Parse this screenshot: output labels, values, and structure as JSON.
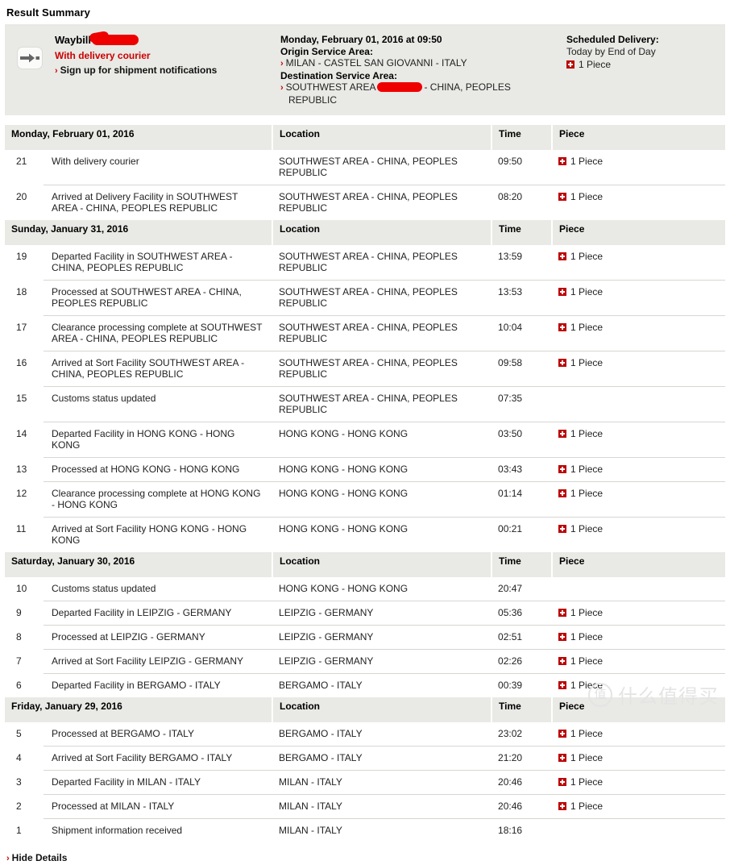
{
  "page": {
    "title": "Result Summary",
    "footer_link": "Hide Details",
    "footer_chevron": "›"
  },
  "summary": {
    "icon": "shipment-arrow-icon",
    "waybill_label": "Waybill",
    "waybill_redacted": true,
    "status": "With delivery courier",
    "notify_link": "Sign up for shipment notifications",
    "notify_chevron": "›",
    "datetime": "Monday, February 01, 2016 at 09:50",
    "origin_label": "Origin Service Area:",
    "origin_value": "MILAN - CASTEL SAN GIOVANNI - ITALY",
    "origin_chevron": "›",
    "destination_label": "Destination Service Area:",
    "destination_chevron": "›",
    "destination_prefix": "SOUTHWEST AREA",
    "destination_redacted": true,
    "destination_suffix": "- CHINA, PEOPLES",
    "destination_line2": "REPUBLIC",
    "scheduled_label": "Scheduled Delivery:",
    "scheduled_value": "Today by End of Day",
    "scheduled_piece": "1 Piece"
  },
  "columns": {
    "location": "Location",
    "time": "Time",
    "piece": "Piece"
  },
  "groups": [
    {
      "date": "Monday, February 01, 2016",
      "events": [
        {
          "num": "21",
          "desc": "With delivery courier",
          "loc": "SOUTHWEST AREA - CHINA, PEOPLES REPUBLIC",
          "time": "09:50",
          "piece": "1 Piece"
        },
        {
          "num": "20",
          "desc": "Arrived at Delivery Facility in SOUTHWEST AREA - CHINA, PEOPLES REPUBLIC",
          "loc": "SOUTHWEST AREA - CHINA, PEOPLES REPUBLIC",
          "time": "08:20",
          "piece": "1 Piece"
        }
      ]
    },
    {
      "date": "Sunday, January 31, 2016",
      "events": [
        {
          "num": "19",
          "desc": "Departed Facility in SOUTHWEST AREA - CHINA, PEOPLES REPUBLIC",
          "loc": "SOUTHWEST AREA - CHINA, PEOPLES REPUBLIC",
          "time": "13:59",
          "piece": "1 Piece"
        },
        {
          "num": "18",
          "desc": "Processed at SOUTHWEST AREA - CHINA, PEOPLES REPUBLIC",
          "loc": "SOUTHWEST AREA - CHINA, PEOPLES REPUBLIC",
          "time": "13:53",
          "piece": "1 Piece"
        },
        {
          "num": "17",
          "desc": "Clearance processing complete at SOUTHWEST AREA - CHINA, PEOPLES REPUBLIC",
          "loc": "SOUTHWEST AREA - CHINA, PEOPLES REPUBLIC",
          "time": "10:04",
          "piece": "1 Piece"
        },
        {
          "num": "16",
          "desc": "Arrived at Sort Facility SOUTHWEST AREA - CHINA, PEOPLES REPUBLIC",
          "loc": "SOUTHWEST AREA - CHINA, PEOPLES REPUBLIC",
          "time": "09:58",
          "piece": "1 Piece"
        },
        {
          "num": "15",
          "desc": "Customs status updated",
          "loc": "SOUTHWEST AREA - CHINA, PEOPLES REPUBLIC",
          "time": "07:35",
          "piece": ""
        },
        {
          "num": "14",
          "desc": "Departed Facility in HONG KONG - HONG KONG",
          "loc": "HONG KONG - HONG KONG",
          "time": "03:50",
          "piece": "1 Piece"
        },
        {
          "num": "13",
          "desc": "Processed at HONG KONG - HONG KONG",
          "loc": "HONG KONG - HONG KONG",
          "time": "03:43",
          "piece": "1 Piece"
        },
        {
          "num": "12",
          "desc": "Clearance processing complete at HONG KONG - HONG KONG",
          "loc": "HONG KONG - HONG KONG",
          "time": "01:14",
          "piece": "1 Piece"
        },
        {
          "num": "11",
          "desc": "Arrived at Sort Facility HONG KONG - HONG KONG",
          "loc": "HONG KONG - HONG KONG",
          "time": "00:21",
          "piece": "1 Piece"
        }
      ]
    },
    {
      "date": "Saturday, January 30, 2016",
      "events": [
        {
          "num": "10",
          "desc": "Customs status updated",
          "loc": "HONG KONG - HONG KONG",
          "time": "20:47",
          "piece": ""
        },
        {
          "num": "9",
          "desc": "Departed Facility in LEIPZIG - GERMANY",
          "loc": "LEIPZIG - GERMANY",
          "time": "05:36",
          "piece": "1 Piece"
        },
        {
          "num": "8",
          "desc": "Processed at LEIPZIG - GERMANY",
          "loc": "LEIPZIG - GERMANY",
          "time": "02:51",
          "piece": "1 Piece"
        },
        {
          "num": "7",
          "desc": "Arrived at Sort Facility LEIPZIG - GERMANY",
          "loc": "LEIPZIG - GERMANY",
          "time": "02:26",
          "piece": "1 Piece"
        },
        {
          "num": "6",
          "desc": "Departed Facility in BERGAMO - ITALY",
          "loc": "BERGAMO - ITALY",
          "time": "00:39",
          "piece": "1 Piece"
        }
      ]
    },
    {
      "date": "Friday, January 29, 2016",
      "events": [
        {
          "num": "5",
          "desc": "Processed at BERGAMO - ITALY",
          "loc": "BERGAMO - ITALY",
          "time": "23:02",
          "piece": "1 Piece"
        },
        {
          "num": "4",
          "desc": "Arrived at Sort Facility BERGAMO - ITALY",
          "loc": "BERGAMO - ITALY",
          "time": "21:20",
          "piece": "1 Piece"
        },
        {
          "num": "3",
          "desc": "Departed Facility in MILAN - ITALY",
          "loc": "MILAN - ITALY",
          "time": "20:46",
          "piece": "1 Piece"
        },
        {
          "num": "2",
          "desc": "Processed at MILAN - ITALY",
          "loc": "MILAN - ITALY",
          "time": "20:46",
          "piece": "1 Piece"
        },
        {
          "num": "1",
          "desc": "Shipment information received",
          "loc": "MILAN - ITALY",
          "time": "18:16",
          "piece": ""
        }
      ]
    }
  ],
  "watermark": {
    "mark": "值",
    "text": "什么值得买"
  },
  "colors": {
    "accent_red": "#cc0000",
    "redaction": "#ee0000",
    "panel_bg": "#e9e9e5",
    "piece_badge": "#bb0000"
  }
}
